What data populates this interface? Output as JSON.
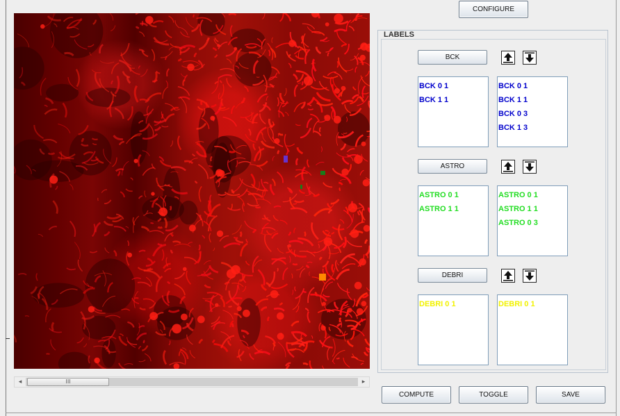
{
  "toolbar": {
    "configure_label": "CONFIGURE"
  },
  "labels_panel": {
    "title": "LABELS",
    "groups": [
      {
        "button_label": "BCK",
        "color": "#0000cc",
        "left_list": [
          "BCK 0 1",
          "BCK 1 1"
        ],
        "right_list": [
          "BCK 0 1",
          "BCK 1 1",
          "BCK 0 3",
          "BCK 1 3"
        ]
      },
      {
        "button_label": "ASTRO",
        "color": "#22dd22",
        "left_list": [
          "ASTRO 0 1",
          "ASTRO 1 1"
        ],
        "right_list": [
          "ASTRO 0 1",
          "ASTRO 1 1",
          "ASTRO 0 3"
        ]
      },
      {
        "button_label": "DEBRI",
        "color": "#f2f200",
        "left_list": [
          "DEBRI 0 1"
        ],
        "right_list": [
          "DEBRI 0 1"
        ]
      }
    ]
  },
  "actions": {
    "compute_label": "COMPUTE",
    "toggle_label": "TOGGLE",
    "save_label": "SAVE"
  },
  "scrollbar": {
    "thumb_grip": "III",
    "left_arrow": "◂",
    "right_arrow": "▸"
  },
  "markers": [
    {
      "color": "#6633cc"
    },
    {
      "color": "#1a7a1a"
    },
    {
      "color": "#1a7a1a"
    },
    {
      "color": "#ff8800"
    }
  ],
  "icons": {
    "up": "arrow-up-icon",
    "down": "arrow-down-icon"
  }
}
